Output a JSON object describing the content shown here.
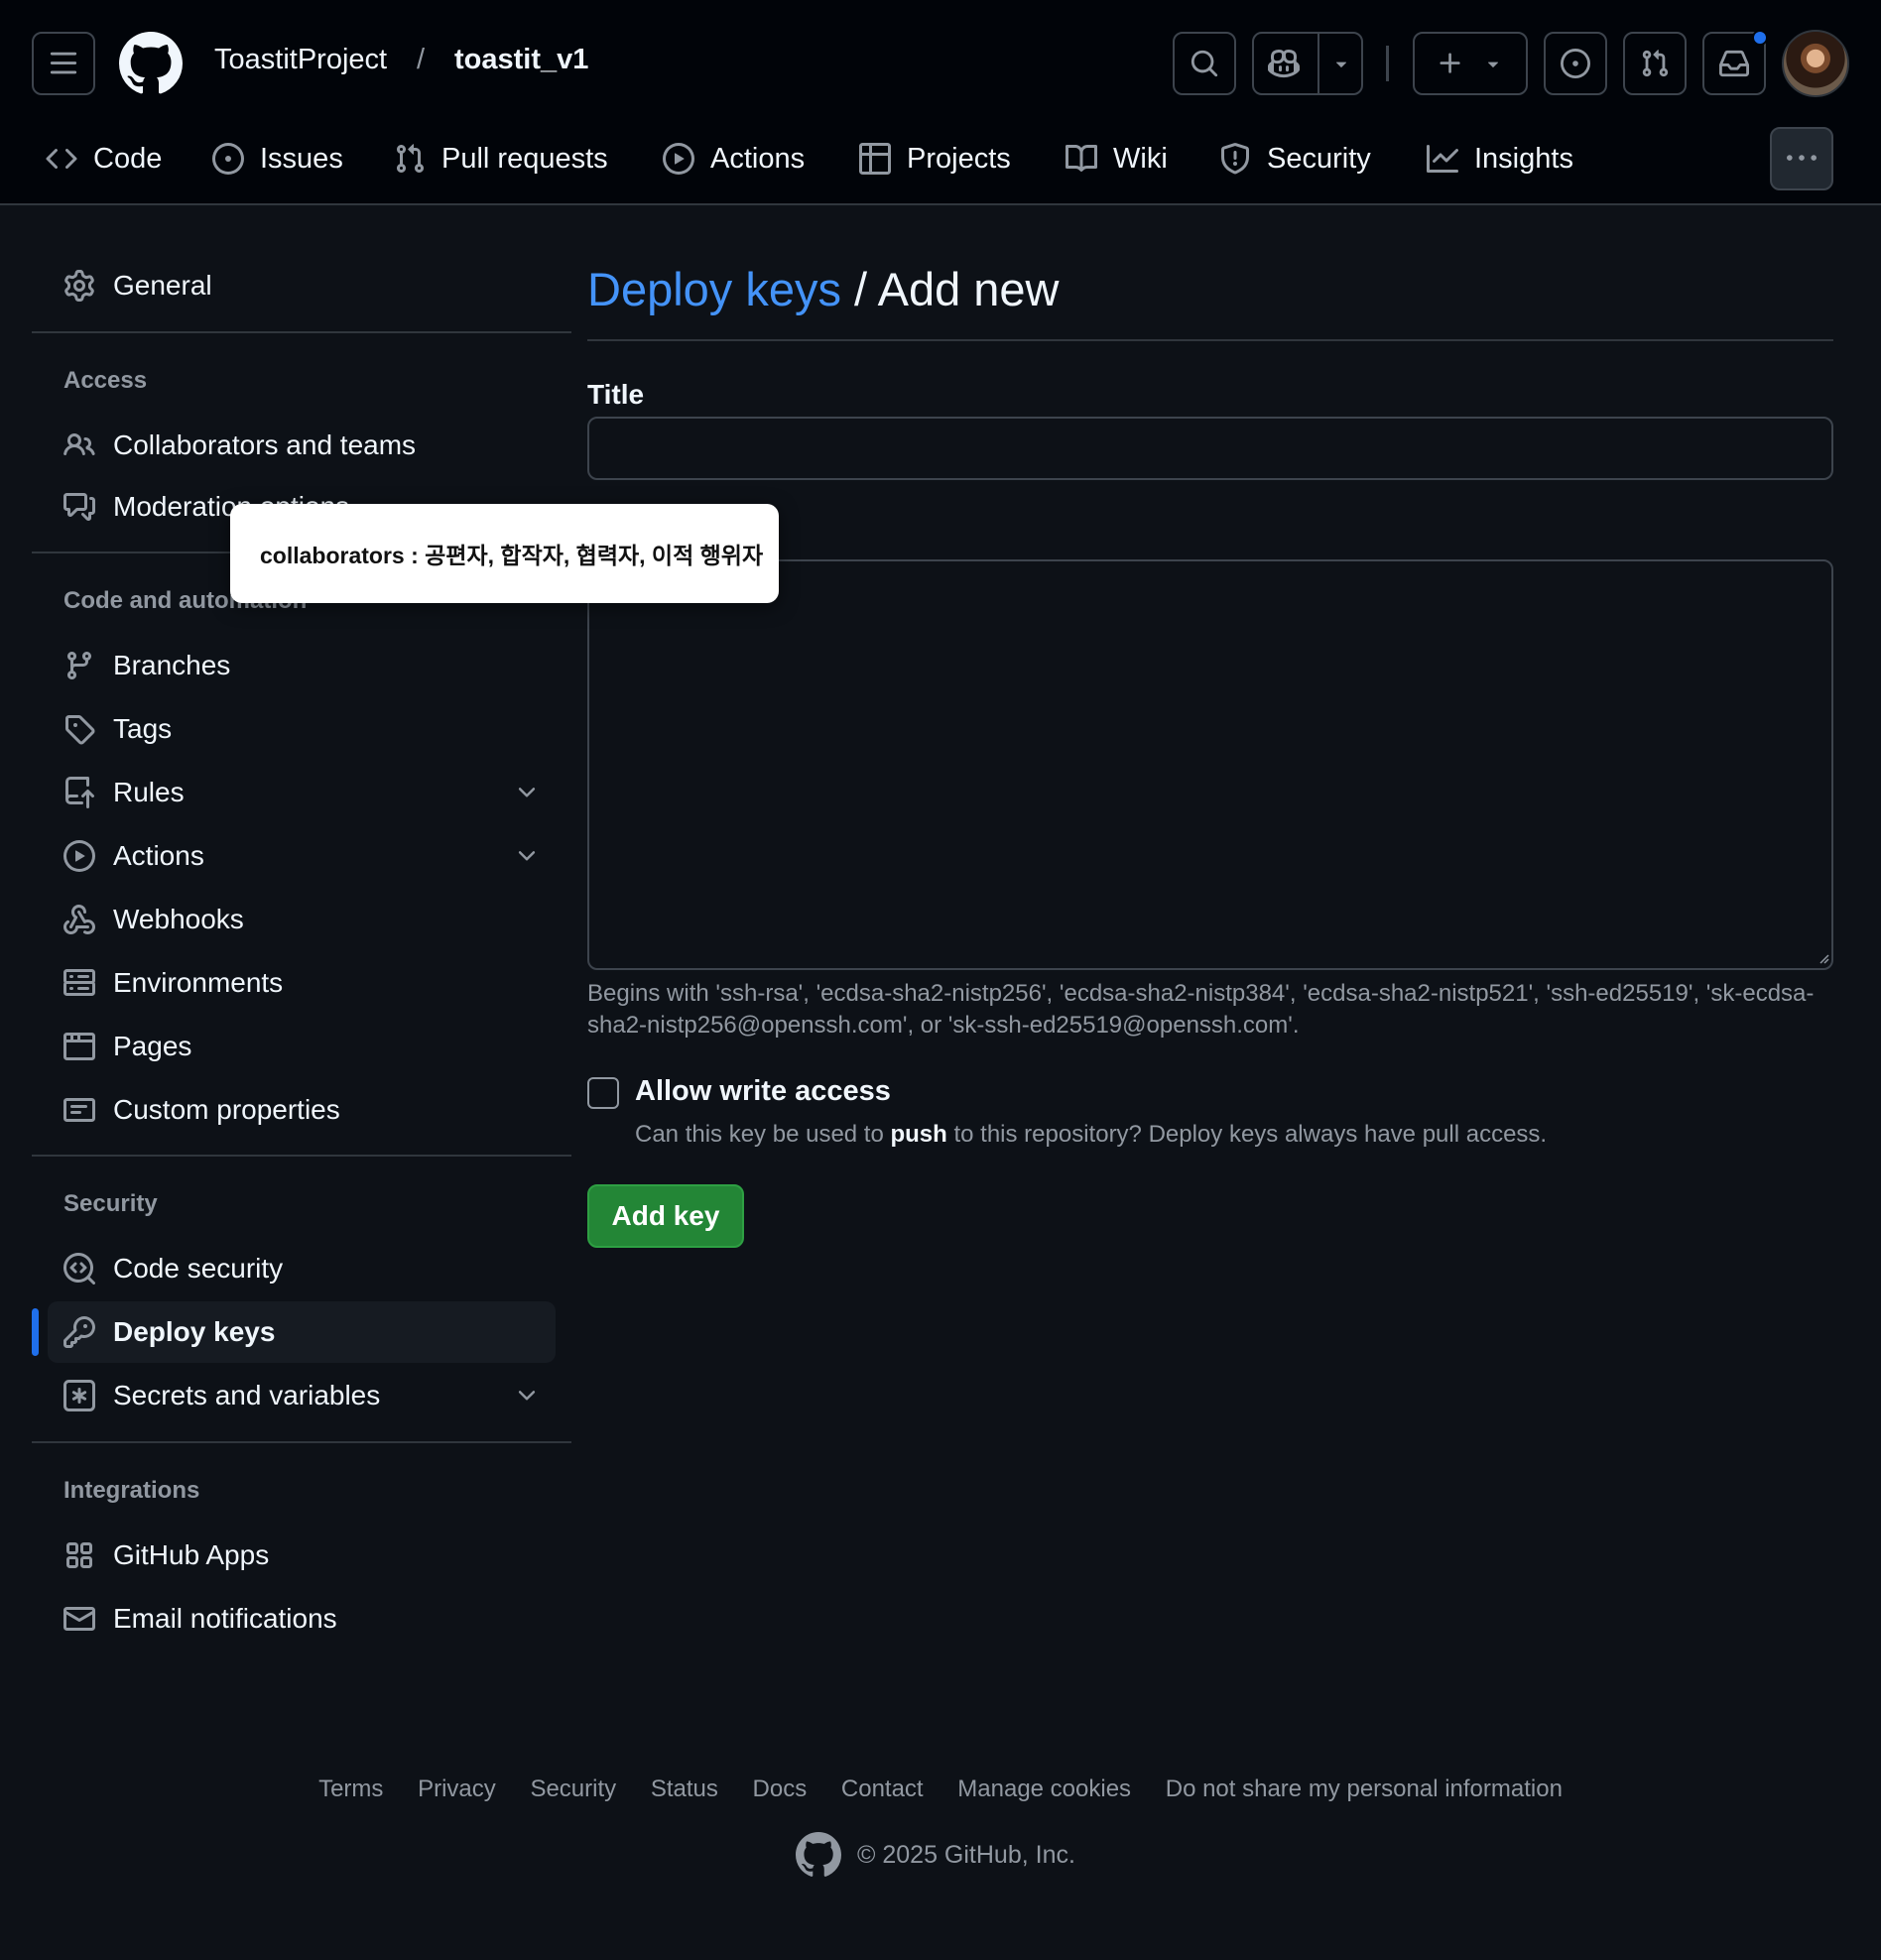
{
  "header": {
    "owner": "ToastitProject",
    "separator": "/",
    "repo": "toastit_v1",
    "icons": [
      "menu-icon",
      "github-logo-icon",
      "search-icon",
      "copilot-icon",
      "triangle-down-icon",
      "plus-icon",
      "issue-opened-icon",
      "git-pull-request-icon",
      "inbox-icon",
      "avatar"
    ]
  },
  "repo_nav": {
    "tabs": [
      {
        "label": "Code",
        "icon": "code-icon"
      },
      {
        "label": "Issues",
        "icon": "issue-opened-icon"
      },
      {
        "label": "Pull requests",
        "icon": "git-pull-request-icon"
      },
      {
        "label": "Actions",
        "icon": "play-icon"
      },
      {
        "label": "Projects",
        "icon": "table-icon"
      },
      {
        "label": "Wiki",
        "icon": "book-icon"
      },
      {
        "label": "Security",
        "icon": "shield-icon"
      },
      {
        "label": "Insights",
        "icon": "graph-icon"
      }
    ],
    "more": "kebab-horizontal-icon"
  },
  "sidebar": {
    "general": "General",
    "access_heading": "Access",
    "access_items": [
      "Collaborators and teams",
      "Moderation options"
    ],
    "code_heading": "Code and automation",
    "code_items": [
      "Branches",
      "Tags",
      "Rules",
      "Actions",
      "Webhooks",
      "Environments",
      "Pages",
      "Custom properties"
    ],
    "security_heading": "Security",
    "security_items": [
      "Code security",
      "Deploy keys",
      "Secrets and variables"
    ],
    "integrations_heading": "Integrations",
    "integrations_items": [
      "GitHub Apps",
      "Email notifications"
    ],
    "active_item": "Deploy keys"
  },
  "main": {
    "breadcrumb_link": "Deploy keys",
    "breadcrumb_sep": " / ",
    "page_title": "Add new",
    "title_label": "Title",
    "title_value": "",
    "key_value": "",
    "key_hint": "Begins with 'ssh-rsa', 'ecdsa-sha2-nistp256', 'ecdsa-sha2-nistp384', 'ecdsa-sha2-nistp521', 'ssh-ed25519', 'sk-ecdsa-sha2-nistp256@openssh.com', or 'sk-ssh-ed25519@openssh.com'.",
    "allow_write_label": "Allow write access",
    "allow_write_checked": false,
    "allow_write_note_before": "Can this key be used to ",
    "allow_write_note_bold": "push",
    "allow_write_note_after": " to this repository? Deploy keys always have pull access.",
    "submit_label": "Add key"
  },
  "tooltip": {
    "text": "collaborators : 공편자, 합작자, 협력자, 이적 행위자"
  },
  "footer": {
    "links": [
      "Terms",
      "Privacy",
      "Security",
      "Status",
      "Docs",
      "Contact",
      "Manage cookies",
      "Do not share my personal information"
    ],
    "copyright": "© 2025 GitHub, Inc."
  },
  "colors": {
    "background": "#0d1117",
    "header_bg": "#010409",
    "accent_link": "#4493f8",
    "active_bar": "#1f6feb",
    "button_green": "#238636",
    "muted_text": "#9198a1",
    "border": "#3d444d"
  }
}
